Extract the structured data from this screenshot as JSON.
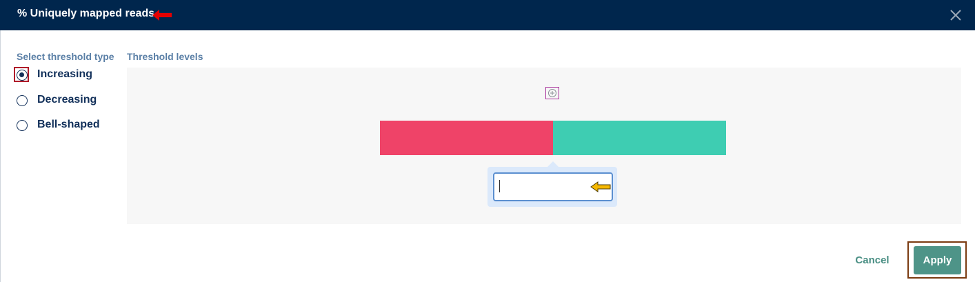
{
  "dialog": {
    "title": "% Uniquely mapped reads",
    "icons": {
      "close": "close-icon",
      "title_arrow": "arrow-left-icon",
      "add": "plus-circle-icon",
      "input_arrow": "arrow-left-icon"
    }
  },
  "threshold_type": {
    "label": "Select threshold type",
    "options": [
      {
        "label": "Increasing",
        "selected": true
      },
      {
        "label": "Decreasing",
        "selected": false
      },
      {
        "label": "Bell-shaped",
        "selected": false
      }
    ]
  },
  "threshold_levels": {
    "label": "Threshold levels",
    "segments": [
      {
        "color": "#ef4368"
      },
      {
        "color": "#3ecdb2"
      }
    ],
    "input": {
      "value": ""
    }
  },
  "footer": {
    "cancel_label": "Cancel",
    "apply_label": "Apply"
  },
  "colors": {
    "header_bg": "#00264d",
    "accent_teal": "#4e9488",
    "label_blue": "#5a7fa6",
    "annotation_red": "#e60000",
    "annotation_yellow": "#f5b800"
  }
}
